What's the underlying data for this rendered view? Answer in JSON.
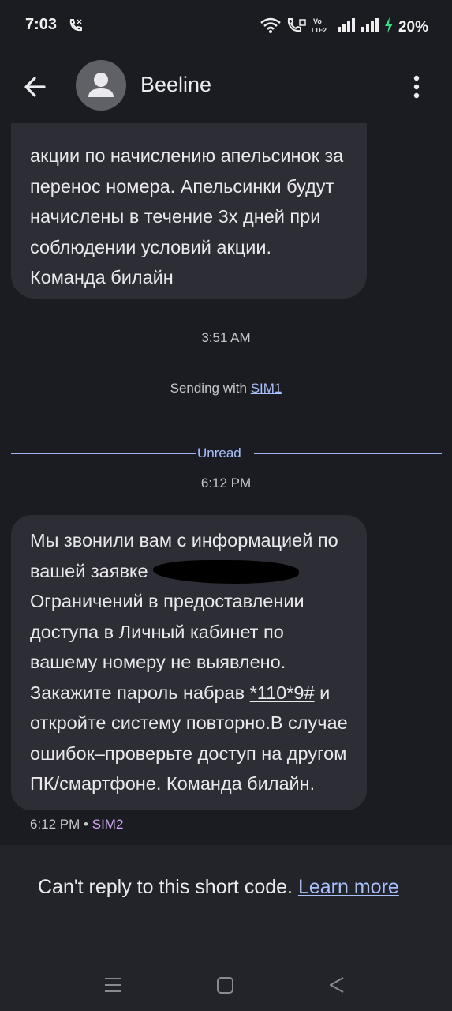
{
  "status_bar": {
    "time": "7:03",
    "battery": "20%"
  },
  "header": {
    "contact_name": "Beeline"
  },
  "messages": [
    {
      "lines": [
        "акции по начислению апельсинок за",
        "перенос номера. Апельсинки будут",
        "начислены в течение 3х дней при",
        "соблюдении условий акции.",
        "Команда билайн"
      ]
    },
    {
      "line1": "Мы звонили вам с информацией по",
      "line2_prefix": "вашей заявке",
      "line3": "Ограничений в предоставлении",
      "line4": "доступа в Личный кабинет по",
      "line5": "вашему номеру не выявлено.",
      "line6_prefix": "Закажите пароль набрав",
      "ussd_code": "*110*9#",
      "line6_suffix": "и",
      "line7": "откройте систему повторно.В случае",
      "line8": "ошибок–проверьте доступ на другом",
      "line9": "ПК/смартфоне. Команда билайн."
    }
  ],
  "timestamps": {
    "first": "3:51 AM",
    "second": "6:12 PM",
    "last_message_time": "6:12 PM",
    "last_message_sim": "SIM2"
  },
  "sending_info": {
    "prefix": "Sending with",
    "sim": "SIM1"
  },
  "unread_divider": "Unread",
  "reply_panel": {
    "text": "Can't reply to this short code.",
    "link": "Learn more"
  },
  "colors": {
    "background": "#1b1c21",
    "bubble": "#2d2e35",
    "accent_link": "#a9c0ff",
    "sim2": "#d8a8ff"
  }
}
